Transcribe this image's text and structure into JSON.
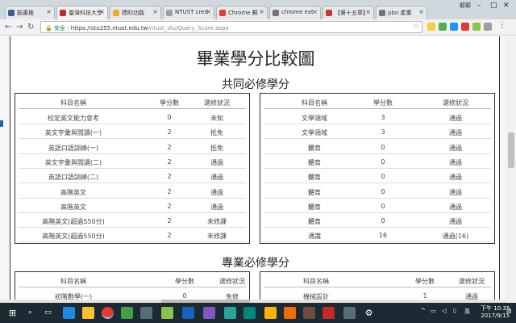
{
  "browser": {
    "tabs": [
      {
        "label": "臉書推",
        "fav_color": "#3b5998"
      },
      {
        "label": "臺灣科技大學",
        "fav_color": "#c62828"
      },
      {
        "label": "標的功能",
        "fav_color": "#f9a825"
      },
      {
        "label": "NTUST cred",
        "fav_color": "#9e9e9e"
      },
      {
        "label": "Chrome 郵",
        "fav_color": "#e53935"
      },
      {
        "label": "chrome ext",
        "fav_color": "#757575"
      },
      {
        "label": "【第十五章】",
        "fav_color": "#d32f2f"
      },
      {
        "label": "pbn 產業",
        "fav_color": "#757575"
      }
    ],
    "user_label": "耶耶",
    "address": {
      "secure_label": "安全",
      "host": "https://stu255.ntust.edu.tw",
      "path": "/ntust_stu/Query_Score.aspx"
    }
  },
  "page": {
    "title": "畢業學分比較圖",
    "section1_title": "共同必修學分",
    "section2_title": "專業必修學分",
    "columns": {
      "name": "科目名稱",
      "credits": "學分數",
      "status": "選修狀況"
    },
    "common_left": [
      {
        "name": "校定英文能力會考",
        "credits": "0",
        "status": "未知"
      },
      {
        "name": "英文字彙與閱讀(一)",
        "credits": "2",
        "status": "抵免"
      },
      {
        "name": "英語口語訓練(一)",
        "credits": "2",
        "status": "抵免"
      },
      {
        "name": "英文字彙與閱讀(二)",
        "credits": "2",
        "status": "通過"
      },
      {
        "name": "英語口語訓練(二)",
        "credits": "2",
        "status": "通過"
      },
      {
        "name": "高階英文",
        "credits": "2",
        "status": "通過"
      },
      {
        "name": "高階英文",
        "credits": "2",
        "status": "通過"
      },
      {
        "name": "高階英文(超過550分)",
        "credits": "2",
        "status": "未修課"
      },
      {
        "name": "高階英文(超過550分)",
        "credits": "2",
        "status": "未修課"
      }
    ],
    "common_right": [
      {
        "name": "文學領域",
        "credits": "3",
        "status": "通過"
      },
      {
        "name": "文學領域",
        "credits": "3",
        "status": "通過"
      },
      {
        "name": "體育",
        "credits": "0",
        "status": "通過"
      },
      {
        "name": "體育",
        "credits": "0",
        "status": "通過"
      },
      {
        "name": "體育",
        "credits": "0",
        "status": "通過"
      },
      {
        "name": "體育",
        "credits": "0",
        "status": "通過"
      },
      {
        "name": "體育",
        "credits": "0",
        "status": "通過"
      },
      {
        "name": "體育",
        "credits": "0",
        "status": "通過"
      },
      {
        "name": "通識",
        "credits": "16",
        "status": "通過(16)"
      }
    ],
    "major_left": [
      {
        "name": "初階數學(一)",
        "credits": "0",
        "status": "免修"
      }
    ],
    "major_right": [
      {
        "name": "機械設計",
        "credits": "1",
        "status": "通過"
      }
    ]
  },
  "taskbar": {
    "clock_time": "下午 10:35",
    "clock_date": "2017/9/15"
  }
}
